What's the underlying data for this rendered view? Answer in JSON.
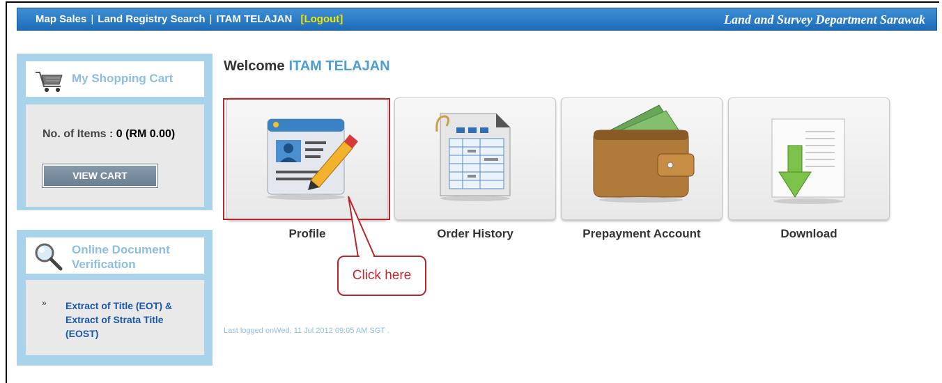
{
  "topbar": {
    "nav": [
      "Map Sales",
      "Land Registry Search",
      "ITAM TELAJAN"
    ],
    "logout": "[Logout]",
    "department": "Land and Survey Department Sarawak"
  },
  "cart": {
    "title": "My Shopping Cart",
    "items_label": "No. of Items : ",
    "items_value": "0 (RM 0.00)",
    "view_button": "VIEW CART"
  },
  "verification": {
    "title_line1": "Online Document",
    "title_line2": "Verification",
    "bullet": "»",
    "link": "Extract of Title (EOT) & Extract of Strata Title (EOST)"
  },
  "main": {
    "welcome": "Welcome",
    "username": "ITAM TELAJAN",
    "tiles": [
      {
        "label": "Profile",
        "icon": "profile-card-icon"
      },
      {
        "label": "Order History",
        "icon": "order-history-icon"
      },
      {
        "label": "Prepayment Account",
        "icon": "wallet-icon"
      },
      {
        "label": "Download",
        "icon": "download-icon"
      }
    ],
    "callout": "Click here",
    "last_login": "Last logged onWed, 11 Jul 2012 09:05 AM SGT ."
  },
  "colors": {
    "topbar": "#1d6cba",
    "sidebar": "#a9d3eb",
    "highlight": "#b8262c",
    "username": "#4a9fd5"
  }
}
